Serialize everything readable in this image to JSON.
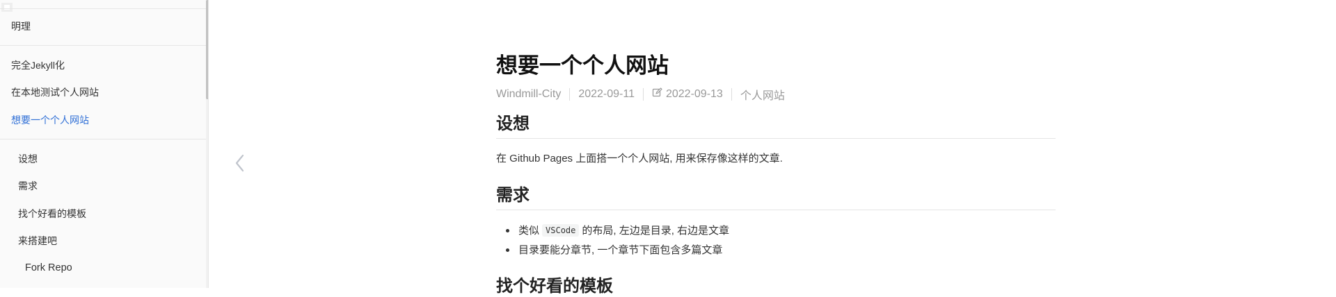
{
  "sidebar": {
    "top_item": "明理",
    "items": [
      {
        "label": "完全Jekyll化"
      },
      {
        "label": "在本地测试个人网站"
      },
      {
        "label": "想要一个个人网站"
      }
    ],
    "toc": [
      {
        "label": "设想"
      },
      {
        "label": "需求"
      },
      {
        "label": "找个好看的模板"
      },
      {
        "label": "来搭建吧"
      }
    ],
    "toc_sub": [
      {
        "label": "Fork Repo"
      }
    ],
    "active_color": "#2f6fd6"
  },
  "article": {
    "title": "想要一个个人网站",
    "meta": {
      "author": "Windmill-City",
      "created": "2022-09-11",
      "updated_icon": "edit-icon",
      "updated": "2022-09-13",
      "category": "个人网站"
    },
    "sections": [
      {
        "heading": "设想",
        "paragraph": "在 Github Pages 上面搭一个个人网站, 用来保存像这样的文章."
      },
      {
        "heading": "需求",
        "list": [
          {
            "before": "类似",
            "code": "VSCode",
            "after": "的布局, 左边是目录, 右边是文章"
          },
          {
            "text": "目录要能分章节, 一个章节下面包含多篇文章"
          }
        ]
      },
      {
        "heading": "找个好看的模板"
      }
    ]
  },
  "nav": {
    "prev_icon": "chevron-left-icon"
  }
}
